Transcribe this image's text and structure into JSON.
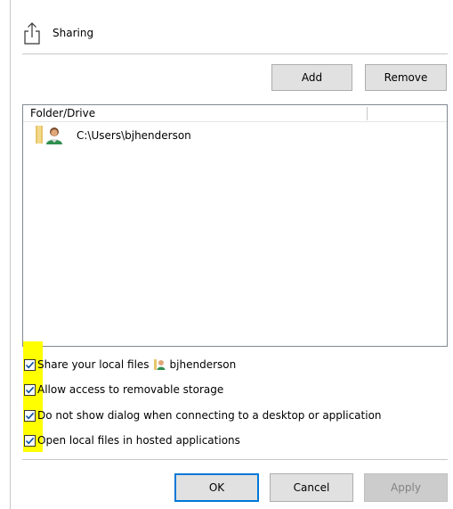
{
  "header": {
    "title": "Sharing",
    "icon": "share-icon"
  },
  "actions": {
    "add_label": "Add",
    "remove_label": "Remove"
  },
  "folder_list": {
    "column_header": "Folder/Drive",
    "items": [
      {
        "label": "C:\\Users\\bjhenderson",
        "icon": "user-folder-icon"
      }
    ]
  },
  "options": [
    {
      "label": "Share your local files",
      "user": "bjhenderson",
      "checked": true
    },
    {
      "label": "Allow access to removable storage",
      "checked": true
    },
    {
      "label": "Do not show dialog when connecting to a desktop or application",
      "checked": true
    },
    {
      "label": "Open local files in hosted applications",
      "checked": true
    }
  ],
  "footer": {
    "ok_label": "OK",
    "cancel_label": "Cancel",
    "apply_label": "Apply"
  },
  "colors": {
    "highlight": "#ffff00",
    "focus_border": "#0078d7",
    "button_bg": "#e1e1e1",
    "disabled_bg": "#cccccc",
    "checkmark": "#0b4f9e"
  }
}
